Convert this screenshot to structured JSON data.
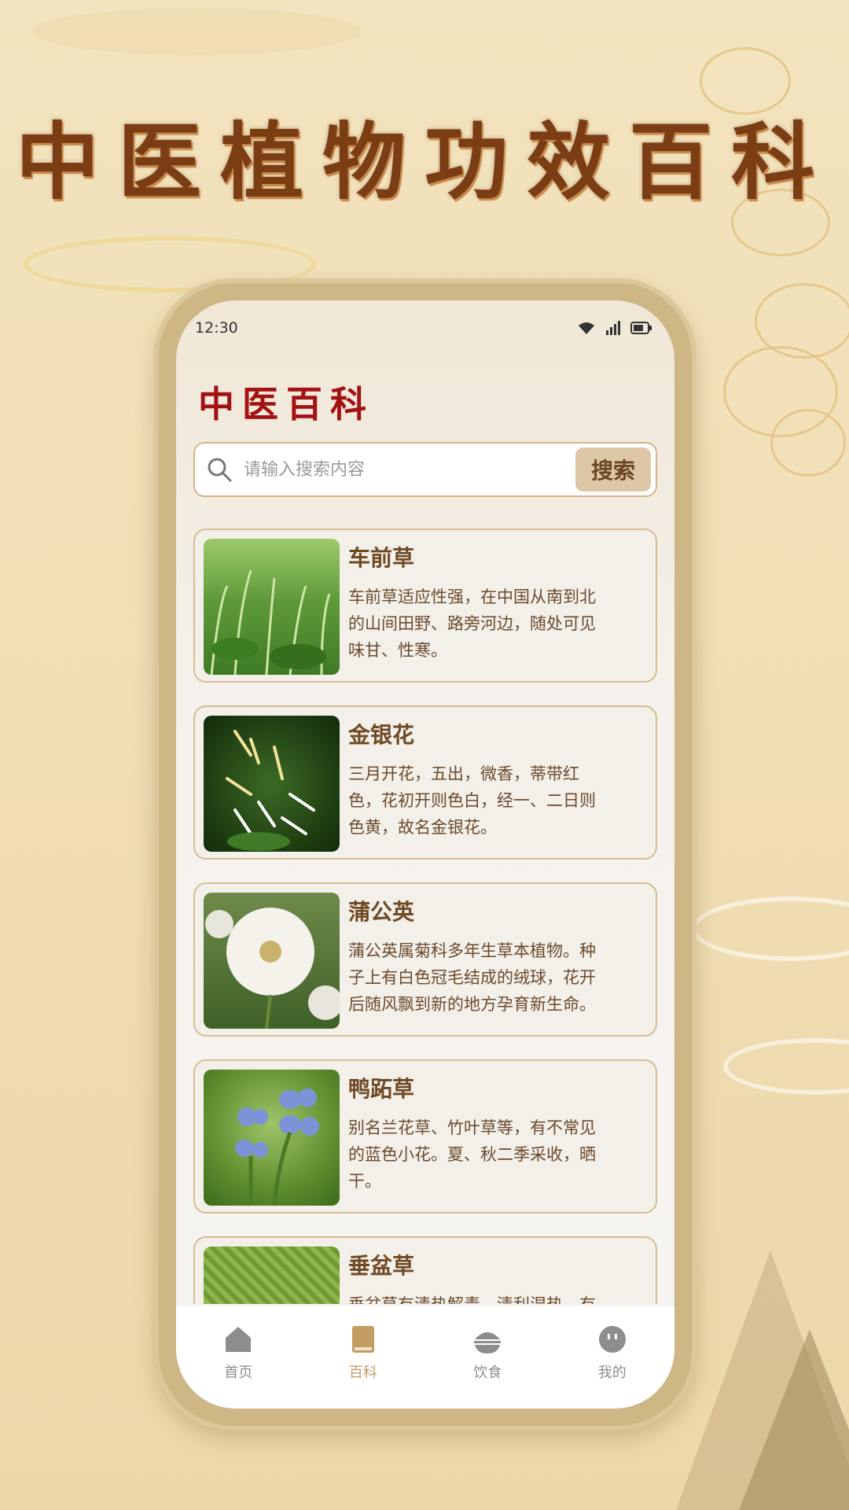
{
  "promo": {
    "title": "中医植物功效百科"
  },
  "status": {
    "time": "12:30",
    "icons": [
      "wifi-icon",
      "signal-icon",
      "battery-icon"
    ]
  },
  "app": {
    "title": "中医百科"
  },
  "search": {
    "placeholder": "请输入搜索内容",
    "button": "搜索"
  },
  "items": [
    {
      "name": "车前草",
      "desc": [
        "车前草适应性强，在中国从南到北",
        "的山间田野、路旁河边，随处可见",
        "味甘、性寒。"
      ]
    },
    {
      "name": "金银花",
      "desc": [
        "三月开花，五出，微香，蒂带红",
        "色，花初开则色白，经一、二日则",
        "色黄，故名金银花。"
      ]
    },
    {
      "name": "蒲公英",
      "desc": [
        "蒲公英属菊科多年生草本植物。种",
        "子上有白色冠毛结成的绒球，花开",
        "后随风飘到新的地方孕育新生命。"
      ]
    },
    {
      "name": "鸭跖草",
      "desc": [
        "别名兰花草、竹叶草等，有不常见",
        "的蓝色小花。夏、秋二季采收，晒",
        "干。"
      ]
    },
    {
      "name": "垂盆草",
      "desc": [
        "垂盆草有清热解毒、清利湿热，有",
        "",
        ""
      ]
    }
  ],
  "tabs": [
    {
      "label": "首页",
      "icon": "home-icon"
    },
    {
      "label": "百科",
      "icon": "book-icon",
      "active": true
    },
    {
      "label": "饮食",
      "icon": "rice-bowl-icon"
    },
    {
      "label": "我的",
      "icon": "face-icon"
    }
  ],
  "colors": {
    "accent": "#c39c63",
    "title_red": "#a31212",
    "brown": "#7a3d14"
  }
}
